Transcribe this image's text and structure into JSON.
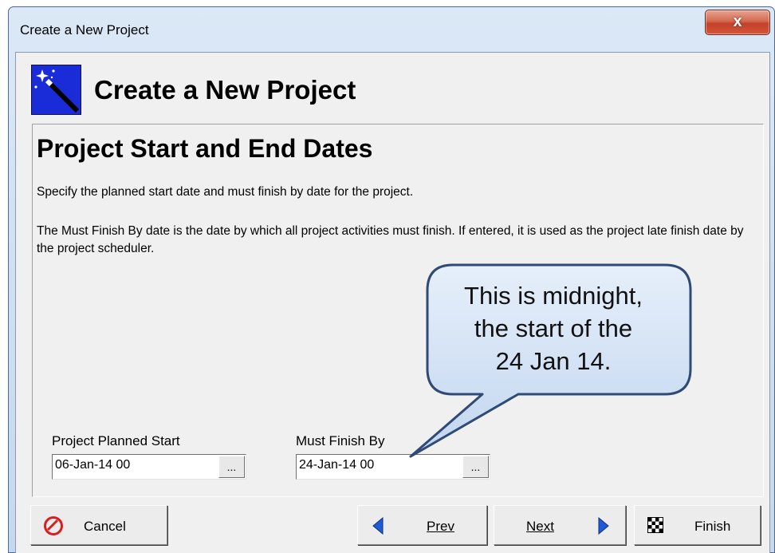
{
  "window": {
    "title": "Create a New Project",
    "close_glyph": "x"
  },
  "header": {
    "title": "Create a New Project",
    "icon": "magic-wand-icon"
  },
  "section": {
    "heading": "Project Start and End Dates",
    "description_1": "Specify the planned start date and must finish by date for the project.",
    "description_2": "The Must Finish By date is the date by which all project activities must finish.  If entered, it is used as the project late finish date by the project scheduler."
  },
  "fields": {
    "planned_start": {
      "label": "Project Planned Start",
      "value": "06-Jan-14 00",
      "button_label": "..."
    },
    "must_finish_by": {
      "label": "Must Finish By",
      "value": "24-Jan-14 00",
      "button_label": "..."
    }
  },
  "callout": {
    "line1": "This is midnight,",
    "line2": "the start of the",
    "line3": "24 Jan 14."
  },
  "buttons": {
    "cancel": {
      "label": "Cancel",
      "icon": "no-entry-icon"
    },
    "prev": {
      "label": "Prev",
      "icon": "arrow-left-icon"
    },
    "next": {
      "label": "Next",
      "icon": "arrow-right-icon"
    },
    "finish": {
      "label": "Finish",
      "icon": "checkered-flag-icon"
    }
  },
  "colors": {
    "callout_fill": "#cfe0f5",
    "callout_border": "#2f4a74",
    "arrow_blue": "#1f5bd6",
    "cancel_red": "#d81f1f"
  }
}
